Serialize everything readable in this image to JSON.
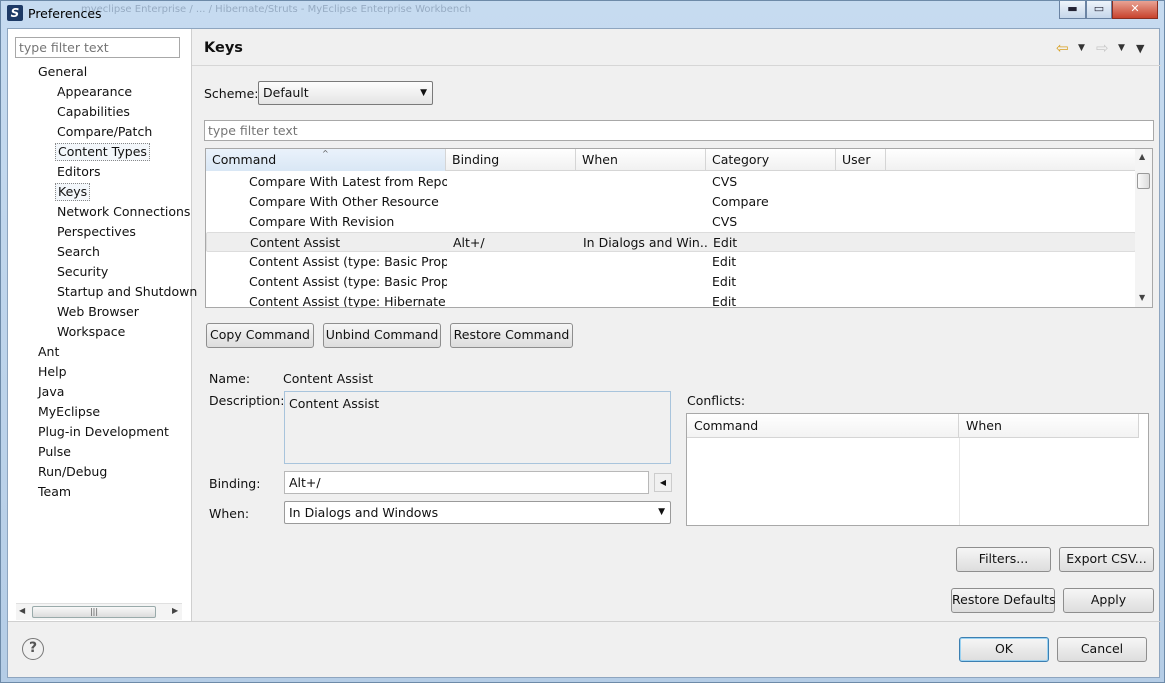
{
  "window": {
    "title": "Preferences",
    "ghost_title": "myeclipse Enterprise / ... / Hibernate/Struts - MyEclipse Enterprise Workbench",
    "controls": {
      "minimize": "▬",
      "maximize": "▭",
      "close": "✕"
    }
  },
  "left_filter": {
    "placeholder": "type filter text"
  },
  "tree": [
    {
      "label": "General",
      "level": 0,
      "expandable": true
    },
    {
      "label": "Appearance",
      "level": 1
    },
    {
      "label": "Capabilities",
      "level": 1
    },
    {
      "label": "Compare/Patch",
      "level": 1
    },
    {
      "label": "Content Types",
      "level": 1,
      "focused": true
    },
    {
      "label": "Editors",
      "level": 1
    },
    {
      "label": "Keys",
      "level": 1,
      "selected": true
    },
    {
      "label": "Network Connections",
      "level": 1
    },
    {
      "label": "Perspectives",
      "level": 1
    },
    {
      "label": "Search",
      "level": 1
    },
    {
      "label": "Security",
      "level": 1
    },
    {
      "label": "Startup and Shutdown",
      "level": 1
    },
    {
      "label": "Web Browser",
      "level": 1
    },
    {
      "label": "Workspace",
      "level": 1
    },
    {
      "label": "Ant",
      "level": 0
    },
    {
      "label": "Help",
      "level": 0
    },
    {
      "label": "Java",
      "level": 0
    },
    {
      "label": "MyEclipse",
      "level": 0
    },
    {
      "label": "Plug-in Development",
      "level": 0
    },
    {
      "label": "Pulse",
      "level": 0
    },
    {
      "label": "Run/Debug",
      "level": 0
    },
    {
      "label": "Team",
      "level": 0
    }
  ],
  "page": {
    "title": "Keys",
    "scheme_label": "Scheme:",
    "scheme_value": "Default",
    "filter_placeholder": "type filter text"
  },
  "table": {
    "headers": [
      "Command",
      "Binding",
      "When",
      "Category",
      "User"
    ],
    "rows": [
      {
        "command": "Compare With Latest from Reposi",
        "binding": "",
        "when": "",
        "category": "CVS"
      },
      {
        "command": "Compare With Other Resource",
        "binding": "",
        "when": "",
        "category": "Compare"
      },
      {
        "command": "Compare With Revision",
        "binding": "",
        "when": "",
        "category": "CVS"
      },
      {
        "command": "Content Assist",
        "binding": "Alt+/",
        "when": "In Dialogs and Win...",
        "category": "Edit",
        "selected": true
      },
      {
        "command": "Content Assist (type: Basic Propos",
        "binding": "",
        "when": "",
        "category": "Edit"
      },
      {
        "command": "Content Assist (type: Basic Propos",
        "binding": "",
        "when": "",
        "category": "Edit"
      },
      {
        "command": "Content Assist (type: Hibernate pr",
        "binding": "",
        "when": "",
        "category": "Edit"
      }
    ]
  },
  "buttons": {
    "copy": "Copy Command",
    "unbind": "Unbind Command",
    "restore": "Restore Command",
    "filters": "Filters...",
    "export": "Export CSV...",
    "restore_defaults": "Restore Defaults",
    "apply": "Apply",
    "ok": "OK",
    "cancel": "Cancel"
  },
  "details": {
    "name_label": "Name:",
    "name_value": "Content Assist",
    "description_label": "Description:",
    "description_value": "Content Assist",
    "binding_label": "Binding:",
    "binding_value": "Alt+/",
    "when_label": "When:",
    "when_value": "In Dialogs and Windows"
  },
  "conflicts": {
    "label": "Conflicts:",
    "headers": [
      "Command",
      "When"
    ]
  },
  "icons": {
    "back": "⇦",
    "forward": "⇨",
    "dropdown": "▼",
    "help": "?",
    "sort": "^",
    "left": "◀",
    "right": "▶",
    "up": "▲",
    "down": "▼",
    "grip": "|||"
  }
}
